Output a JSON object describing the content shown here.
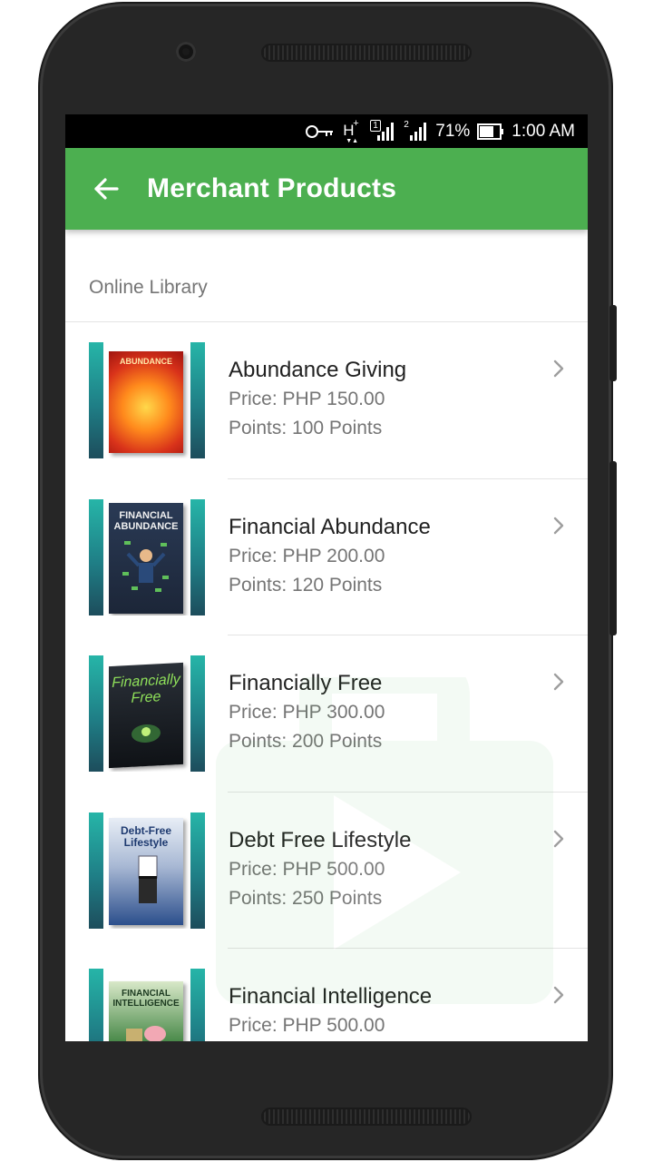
{
  "status_bar": {
    "network_label": "H",
    "sim1_label": "1",
    "sim2_label": "2",
    "battery": "71%",
    "time": "1:00 AM",
    "icons": [
      "key-icon",
      "h-plus-network-icon",
      "signal-sim1-icon",
      "signal-sim2-icon",
      "battery-icon"
    ]
  },
  "app_bar": {
    "title": "Merchant Products",
    "back_icon": "arrow-left-icon"
  },
  "section": {
    "header": "Online Library"
  },
  "products": [
    {
      "name": "Abundance Giving",
      "price": "Price: PHP 150.00",
      "points": "Points: 100 Points",
      "cover_text": "ABUNDANCE",
      "cover_color": "#e0401c"
    },
    {
      "name": "Financial Abundance",
      "price": "Price: PHP 200.00",
      "points": "Points: 120 Points",
      "cover_text": "FINANCIAL ABUNDANCE",
      "cover_color": "#22324a"
    },
    {
      "name": "Financially Free",
      "price": "Price: PHP 300.00",
      "points": "Points: 200 Points",
      "cover_text": "Financially Free",
      "cover_color": "#1a1f26"
    },
    {
      "name": "Debt Free Lifestyle",
      "price": "Price: PHP 500.00",
      "points": "Points: 250 Points",
      "cover_text": "Debt-Free Lifestyle",
      "cover_color": "#2c4f8c"
    },
    {
      "name": "Financial Intelligence",
      "price": "Price: PHP 500.00",
      "points": "",
      "cover_text": "FINANCIAL INTELLIGENCE",
      "cover_color": "#2f6a3a"
    }
  ],
  "colors": {
    "app_bar": "#4caf50",
    "accent_bar": "#26b5a8"
  }
}
